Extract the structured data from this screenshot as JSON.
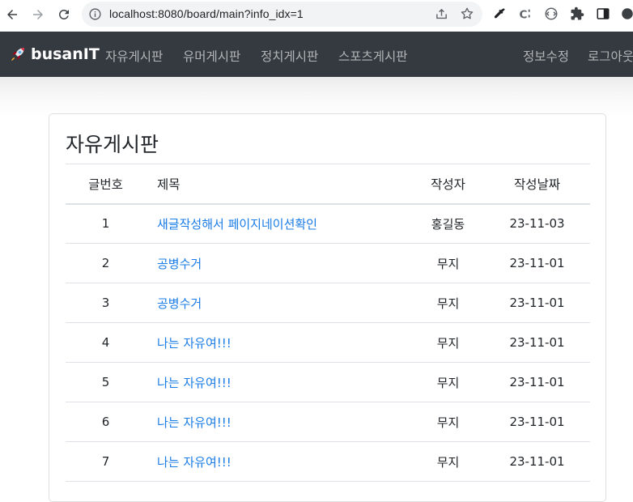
{
  "browser": {
    "url": "localhost:8080/board/main?info_idx=1"
  },
  "navbar": {
    "brand": "busanIT",
    "links": [
      "자유게시판",
      "유머게시판",
      "정치게시판",
      "스포츠게시판"
    ],
    "right_links": [
      "정보수정",
      "로그아웃"
    ]
  },
  "board": {
    "title": "자유게시판",
    "columns": [
      "글번호",
      "제목",
      "작성자",
      "작성날짜"
    ],
    "rows": [
      {
        "num": "1",
        "title": "새글작성해서 페이지네이션확인",
        "writer": "홍길동",
        "date": "23-11-03"
      },
      {
        "num": "2",
        "title": "공병수거",
        "writer": "무지",
        "date": "23-11-01"
      },
      {
        "num": "3",
        "title": "공병수거",
        "writer": "무지",
        "date": "23-11-01"
      },
      {
        "num": "4",
        "title": "나는 자유여!!!",
        "writer": "무지",
        "date": "23-11-01"
      },
      {
        "num": "5",
        "title": "나는 자유여!!!",
        "writer": "무지",
        "date": "23-11-01"
      },
      {
        "num": "6",
        "title": "나는 자유여!!!",
        "writer": "무지",
        "date": "23-11-01"
      },
      {
        "num": "7",
        "title": "나는 자유여!!!",
        "writer": "무지",
        "date": "23-11-01"
      }
    ]
  },
  "colors": {
    "navbar_bg": "#343a40",
    "link": "#1a7ce6",
    "text": "#212529"
  }
}
